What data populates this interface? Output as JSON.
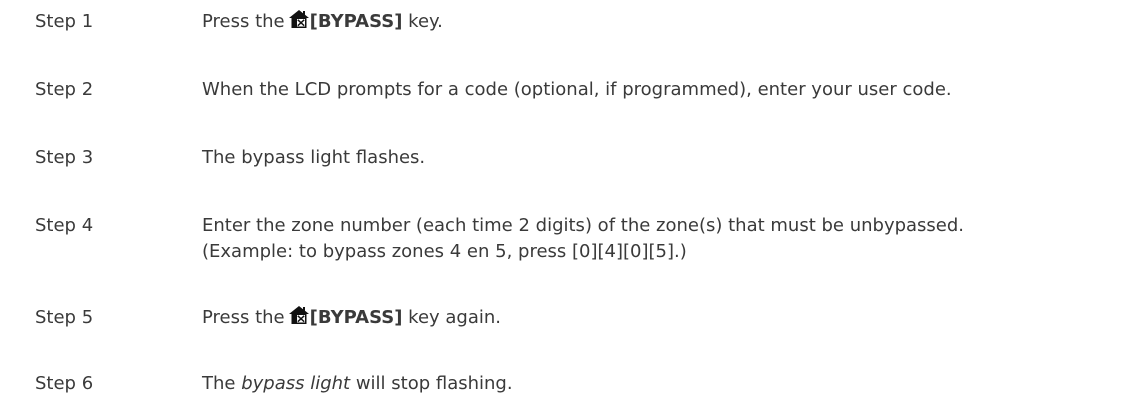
{
  "steps": [
    {
      "label": "Step 1",
      "before": "Press the",
      "key": "[BYPASS]",
      "after": " key.",
      "icon": "bypass-house-icon"
    },
    {
      "label": "Step 2",
      "text": "When the LCD prompts for a code (optional, if programmed), enter your user code."
    },
    {
      "label": "Step 3",
      "text": "The bypass light flashes."
    },
    {
      "label": "Step 4",
      "line1": "Enter the zone number (each time 2 digits) of the zone(s) that must be unbypassed.",
      "line2": "(Example: to bypass zones 4 en 5, press [0][4][0][5].)"
    },
    {
      "label": "Step 5",
      "before": "Press the",
      "key": "[BYPASS]",
      "after": " key again.",
      "icon": "bypass-house-icon"
    },
    {
      "label": "Step 6",
      "before": "The ",
      "emphasis": "bypass light",
      "after": " will stop flashing."
    }
  ]
}
